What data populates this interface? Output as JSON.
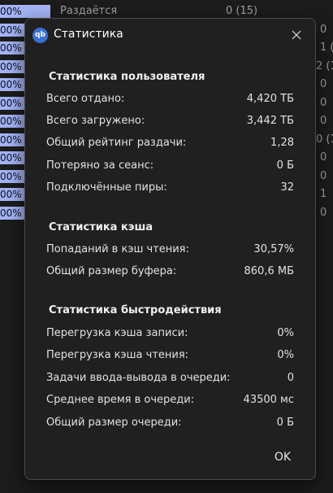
{
  "background": {
    "rows": [
      {
        "progress": "00%",
        "status": "Раздаётся",
        "count": "0 (15)",
        "edge": ""
      },
      {
        "progress": "00%",
        "status": "",
        "count": "",
        "edge": "0"
      },
      {
        "progress": "00%",
        "status": "",
        "count": "",
        "edge": "1 ("
      },
      {
        "progress": "00%",
        "status": "",
        "count": "",
        "edge": "2 (1"
      },
      {
        "progress": "00%",
        "status": "",
        "count": "",
        "edge": "0"
      },
      {
        "progress": "00%",
        "status": "",
        "count": "",
        "edge": "0"
      },
      {
        "progress": "00%",
        "status": "",
        "count": "",
        "edge": "0"
      },
      {
        "progress": "00%",
        "status": "",
        "count": "",
        "edge": "0 (1"
      },
      {
        "progress": "00%",
        "status": "",
        "count": "",
        "edge": "0"
      },
      {
        "progress": "00%",
        "status": "",
        "count": "",
        "edge": "0"
      },
      {
        "progress": "00%",
        "status": "",
        "count": "",
        "edge": "1"
      },
      {
        "progress": "00%",
        "status": "",
        "count": "",
        "edge": "0"
      }
    ]
  },
  "dialog": {
    "title": "Статистика",
    "icon_text": "qb",
    "user_stats": {
      "heading": "Статистика пользователя",
      "rows": [
        {
          "label": "Всего отдано:",
          "value": "4,420 ТБ"
        },
        {
          "label": "Всего загружено:",
          "value": "3,442 ТБ"
        },
        {
          "label": "Общий рейтинг раздачи:",
          "value": "1,28"
        },
        {
          "label": "Потеряно за сеанс:",
          "value": "0 Б"
        },
        {
          "label": "Подключённые пиры:",
          "value": "32"
        }
      ]
    },
    "cache_stats": {
      "heading": "Статистика кэша",
      "rows": [
        {
          "label": "Попаданий в кэш чтения:",
          "value": "30,57%"
        },
        {
          "label": "Общий размер буфера:",
          "value": "860,6 МБ"
        }
      ]
    },
    "perf_stats": {
      "heading": "Статистика быстродействия",
      "rows": [
        {
          "label": "Перегрузка кэша записи:",
          "value": "0%"
        },
        {
          "label": "Перегрузка кэша чтения:",
          "value": "0%"
        },
        {
          "label": "Задачи ввода-вывода в очереди:",
          "value": "0"
        },
        {
          "label": "Среднее время в очереди:",
          "value": "43500 мс"
        },
        {
          "label": "Общий размер очереди:",
          "value": "0 Б"
        }
      ]
    },
    "ok_label": "OK"
  },
  "colors": {
    "progress_bar": "#a4b4f5",
    "dialog_bg": "#202020",
    "app_icon": "#3b6fd0"
  }
}
